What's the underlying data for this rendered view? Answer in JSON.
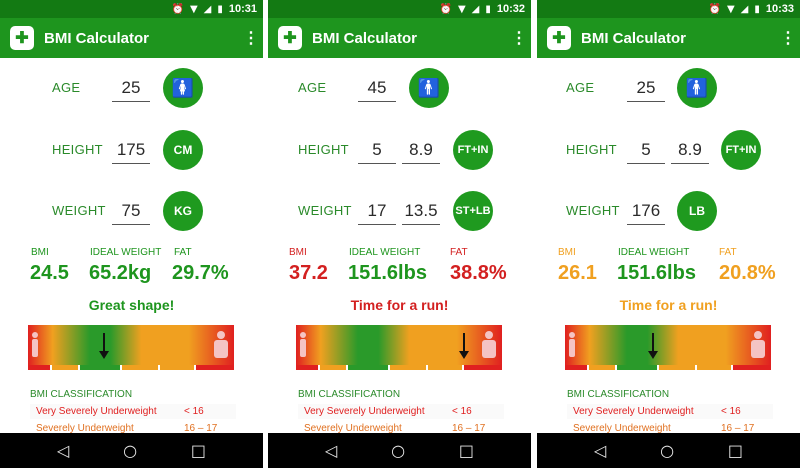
{
  "phones": [
    {
      "status": {
        "time": "10:31"
      },
      "app_title": "BMI Calculator",
      "age": {
        "label": "AGE",
        "value": "25",
        "gender_icon": "female-icon"
      },
      "height": {
        "label": "HEIGHT",
        "value1": "175",
        "value2": "",
        "unit": "CM"
      },
      "weight": {
        "label": "WEIGHT",
        "value1": "75",
        "value2": "",
        "unit": "KG"
      },
      "stats": {
        "bmi_label": "BMI",
        "bmi_value": "24.5",
        "ideal_label": "IDEAL WEIGHT",
        "ideal_value": "65.2kg",
        "fat_label": "FAT",
        "fat_value": "29.7%"
      },
      "message": "Great shape!",
      "status_color": "#1e951e",
      "pointer_fraction": 0.36,
      "figure_icon": "female-figure-icon",
      "classification": {
        "title": "BMI CLASSIFICATION",
        "rows": [
          {
            "category": "Very Severely Underweight",
            "range": "< 16"
          },
          {
            "category": "Severely Underweight",
            "range": "16 – 17"
          }
        ]
      }
    },
    {
      "status": {
        "time": "10:32"
      },
      "app_title": "BMI Calculator",
      "age": {
        "label": "AGE",
        "value": "45",
        "gender_icon": "male-icon"
      },
      "height": {
        "label": "HEIGHT",
        "value1": "5",
        "value2": "8.9",
        "unit": "FT+IN"
      },
      "weight": {
        "label": "WEIGHT",
        "value1": "17",
        "value2": "13.5",
        "unit": "ST+LB"
      },
      "stats": {
        "bmi_label": "BMI",
        "bmi_value": "37.2",
        "ideal_label": "IDEAL WEIGHT",
        "ideal_value": "151.6lbs",
        "fat_label": "FAT",
        "fat_value": "38.8%"
      },
      "message": "Time for a run!",
      "status_color": "#d32020",
      "pointer_fraction": 0.82,
      "figure_icon": "male-figure-icon",
      "classification": {
        "title": "BMI CLASSIFICATION",
        "rows": [
          {
            "category": "Very Severely Underweight",
            "range": "< 16"
          },
          {
            "category": "Severely Underweight",
            "range": "16 – 17"
          }
        ]
      }
    },
    {
      "status": {
        "time": "10:33"
      },
      "app_title": "BMI Calculator",
      "age": {
        "label": "AGE",
        "value": "25",
        "gender_icon": "male-icon"
      },
      "height": {
        "label": "HEIGHT",
        "value1": "5",
        "value2": "8.9",
        "unit": "FT+IN"
      },
      "weight": {
        "label": "WEIGHT",
        "value1": "176",
        "value2": "",
        "unit": "LB"
      },
      "stats": {
        "bmi_label": "BMI",
        "bmi_value": "26.1",
        "ideal_label": "IDEAL WEIGHT",
        "ideal_value": "151.6lbs",
        "fat_label": "FAT",
        "fat_value": "20.8%"
      },
      "message": "Time for a run!",
      "status_color": "#f0a020",
      "pointer_fraction": 0.43,
      "figure_icon": "male-figure-icon",
      "classification": {
        "title": "BMI CLASSIFICATION",
        "rows": [
          {
            "category": "Very Severely Underweight",
            "range": "< 16"
          },
          {
            "category": "Severely Underweight",
            "range": "16 – 17"
          }
        ]
      }
    }
  ],
  "colors": {
    "primary": "#1e951e",
    "status_bar": "#137a13",
    "label": "#2a8a2a"
  }
}
